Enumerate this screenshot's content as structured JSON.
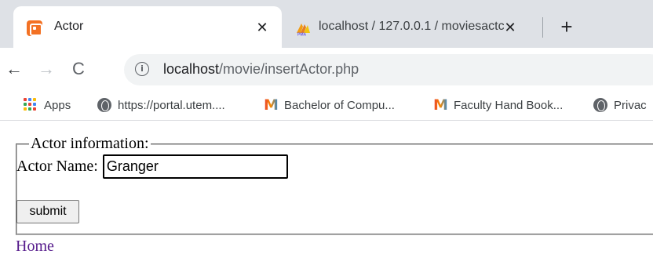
{
  "browser": {
    "tabs": [
      {
        "title": "Actor",
        "active": true,
        "favicon": "xampp-icon",
        "close_glyph": "✕"
      },
      {
        "title": "localhost / 127.0.0.1 / moviesactc",
        "active": false,
        "favicon": "phpmyadmin-icon",
        "close_glyph": "✕"
      }
    ],
    "new_tab_glyph": "+",
    "nav": {
      "back": "←",
      "forward": "→",
      "reload": "C"
    },
    "address": {
      "info_glyph": "i",
      "host": "localhost",
      "path": "/movie/insertActor.php"
    },
    "bookmarks": [
      {
        "label": "Apps",
        "icon": "apps-grid-icon"
      },
      {
        "label": "https://portal.utem....",
        "icon": "globe-icon"
      },
      {
        "label": "Bachelor of Compu...",
        "icon": "m-logo-icon"
      },
      {
        "label": "Faculty Hand Book...",
        "icon": "m-logo-icon"
      },
      {
        "label": "Privac",
        "icon": "globe-icon"
      }
    ]
  },
  "page": {
    "legend": "Actor information:",
    "name_label": "Actor Name:",
    "name_value": "Granger",
    "submit_label": "submit",
    "home_link": "Home"
  },
  "colors": {
    "tab_strip": "#dee1e6",
    "omnibox": "#f1f3f4",
    "link_visited": "#551a8b",
    "xampp_orange": "#f37123"
  }
}
